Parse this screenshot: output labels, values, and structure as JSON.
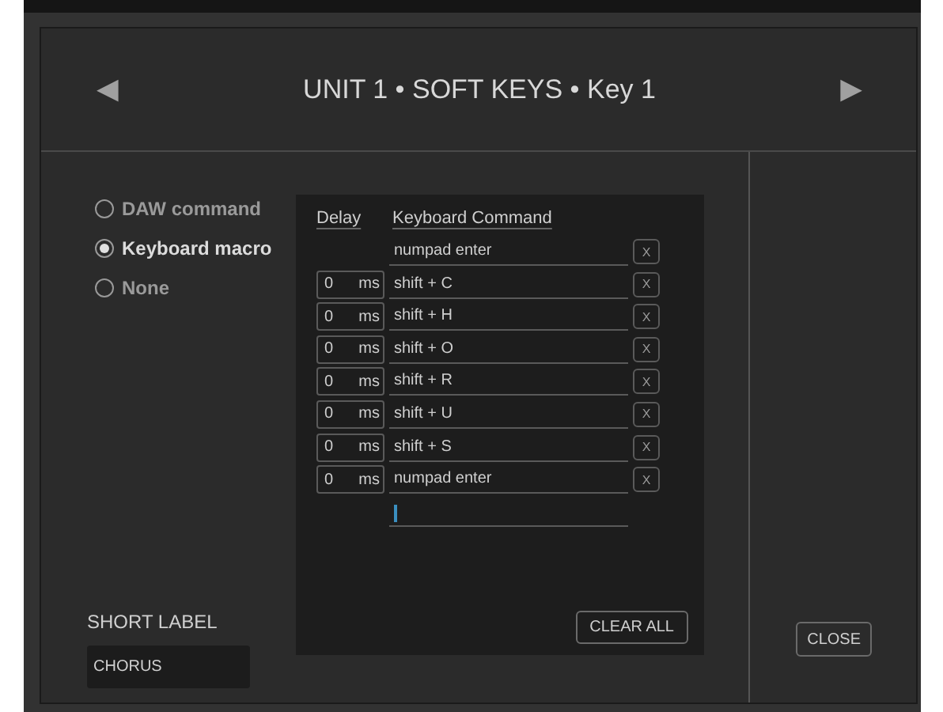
{
  "dialog": {
    "title": "UNIT 1 • SOFT KEYS • Key 1",
    "prev_arrow": "◀",
    "next_arrow": "▶"
  },
  "action_types": [
    {
      "label": "DAW command",
      "selected": false
    },
    {
      "label": "Keyboard macro",
      "selected": true
    },
    {
      "label": "None",
      "selected": false
    }
  ],
  "macro": {
    "columns": [
      "Delay",
      "Keyboard Command"
    ],
    "steps": [
      {
        "kind": "first",
        "command": "numpad enter",
        "remove": "X"
      },
      {
        "kind": "step",
        "delay": "0",
        "unit": "ms",
        "command": "shift + C",
        "remove": "X"
      },
      {
        "kind": "step",
        "delay": "0",
        "unit": "ms",
        "command": "shift + H",
        "remove": "X"
      },
      {
        "kind": "step",
        "delay": "0",
        "unit": "ms",
        "command": "shift + O",
        "remove": "X"
      },
      {
        "kind": "step",
        "delay": "0",
        "unit": "ms",
        "command": "shift + R",
        "remove": "X"
      },
      {
        "kind": "step",
        "delay": "0",
        "unit": "ms",
        "command": "shift + U",
        "remove": "X"
      },
      {
        "kind": "step",
        "delay": "0",
        "unit": "ms",
        "command": "shift + S",
        "remove": "X"
      },
      {
        "kind": "step",
        "delay": "0",
        "unit": "ms",
        "command": "numpad enter",
        "remove": "X"
      }
    ],
    "clear_button": "CLEAR ALL"
  },
  "short_label": {
    "label": "SHORT LABEL",
    "value": "CHORUS"
  },
  "close_button": "CLOSE"
}
